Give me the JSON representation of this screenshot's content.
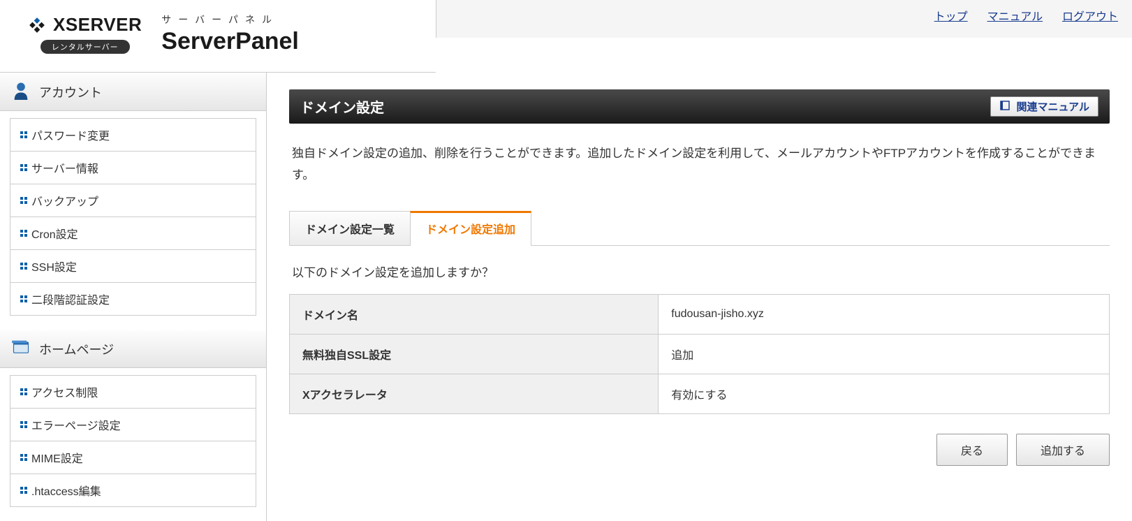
{
  "topLinks": {
    "top": "トップ",
    "manual": "マニュアル",
    "logout": "ログアウト"
  },
  "logo": {
    "brand": "XSERVER",
    "badge": "レンタルサーバー",
    "panelSub": "サーバーパネル",
    "panelMain": "ServerPanel"
  },
  "sidebar": {
    "account": {
      "title": "アカウント",
      "items": [
        "パスワード変更",
        "サーバー情報",
        "バックアップ",
        "Cron設定",
        "SSH設定",
        "二段階認証設定"
      ]
    },
    "homepage": {
      "title": "ホームページ",
      "items": [
        "アクセス制限",
        "エラーページ設定",
        "MIME設定",
        ".htaccess編集"
      ]
    }
  },
  "main": {
    "pageTitle": "ドメイン設定",
    "manualButton": "関連マニュアル",
    "description": "独自ドメイン設定の追加、削除を行うことができます。追加したドメイン設定を利用して、メールアカウントやFTPアカウントを作成することができます。",
    "tabs": {
      "list": "ドメイン設定一覧",
      "add": "ドメイン設定追加"
    },
    "confirmText": "以下のドメイン設定を追加しますか？",
    "table": {
      "domainLabel": "ドメイン名",
      "domainValue": "fudousan-jisho.xyz",
      "sslLabel": "無料独自SSL設定",
      "sslValue": "追加",
      "accelLabel": "Xアクセラレータ",
      "accelValue": "有効にする"
    },
    "buttons": {
      "back": "戻る",
      "add": "追加する"
    }
  }
}
